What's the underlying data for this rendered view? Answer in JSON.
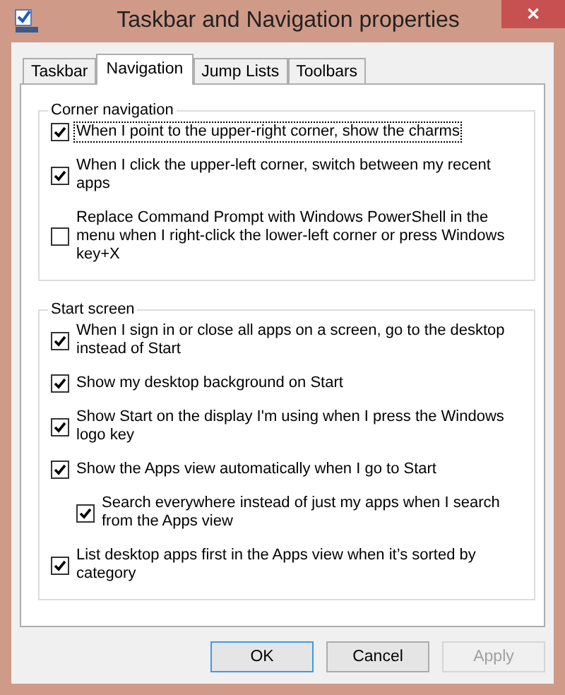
{
  "window": {
    "title": "Taskbar and Navigation properties",
    "close": "✕"
  },
  "tabs": [
    {
      "label": "Taskbar",
      "selected": false
    },
    {
      "label": "Navigation",
      "selected": true
    },
    {
      "label": "Jump Lists",
      "selected": false
    },
    {
      "label": "Toolbars",
      "selected": false
    }
  ],
  "groups": [
    {
      "title": "Corner navigation",
      "options": [
        {
          "label": "When I point to the upper-right corner, show the charms",
          "checked": true,
          "focused": true
        },
        {
          "label": "When I click the upper-left corner, switch between my recent apps",
          "checked": true,
          "focused": false
        },
        {
          "label": "Replace Command Prompt with Windows PowerShell in the menu when I right-click the lower-left corner or press Windows key+X",
          "checked": false,
          "focused": false
        }
      ]
    },
    {
      "title": "Start screen",
      "options": [
        {
          "label": "When I sign in or close all apps on a screen, go to the desktop instead of Start",
          "checked": true,
          "focused": false
        },
        {
          "label": "Show my desktop background on Start",
          "checked": true,
          "focused": false
        },
        {
          "label": "Show Start on the display I'm using when I press the Windows logo key",
          "checked": true,
          "focused": false
        },
        {
          "label": "Show the Apps view automatically when I go to Start",
          "checked": true,
          "focused": false,
          "children": [
            {
              "label": "Search everywhere instead of just my apps when I search from the Apps view",
              "checked": true,
              "focused": false
            }
          ]
        },
        {
          "label": "List desktop apps first in the Apps view when it’s sorted by category",
          "checked": true,
          "focused": false
        }
      ]
    }
  ],
  "buttons": [
    {
      "label": "OK",
      "default": true,
      "disabled": false
    },
    {
      "label": "Cancel",
      "default": false,
      "disabled": false
    },
    {
      "label": "Apply",
      "default": false,
      "disabled": true
    }
  ]
}
